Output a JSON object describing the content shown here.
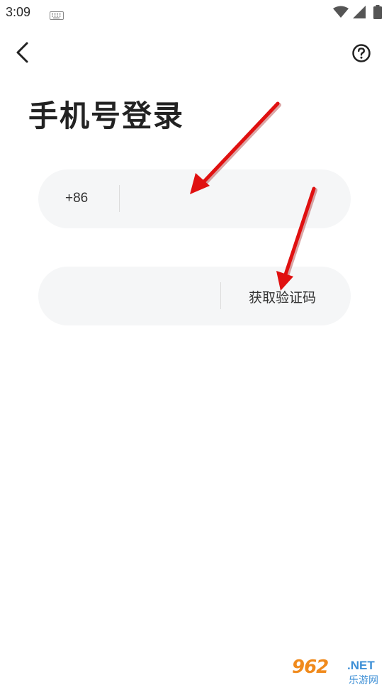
{
  "status_bar": {
    "time": "3:09",
    "icons": [
      "keyboard-icon",
      "wifi-icon",
      "cell-signal-icon",
      "battery-icon"
    ]
  },
  "header": {
    "back_icon": "chevron-left-icon",
    "help_icon": "question-circle-icon"
  },
  "page": {
    "title": "手机号登录"
  },
  "phone_field": {
    "country_code": "+86",
    "value": "",
    "placeholder": ""
  },
  "code_field": {
    "value": "",
    "placeholder": "",
    "get_code_label": "获取验证码"
  },
  "annotations": {
    "arrow_color": "#e01010"
  },
  "watermark": {
    "main": "962",
    "suffix": ".NET",
    "sub": "乐游网"
  },
  "colors": {
    "field_bg": "#f5f6f7",
    "text_primary": "#222222",
    "watermark_orange": "#f08a1c",
    "watermark_blue": "#3d8fd6"
  }
}
